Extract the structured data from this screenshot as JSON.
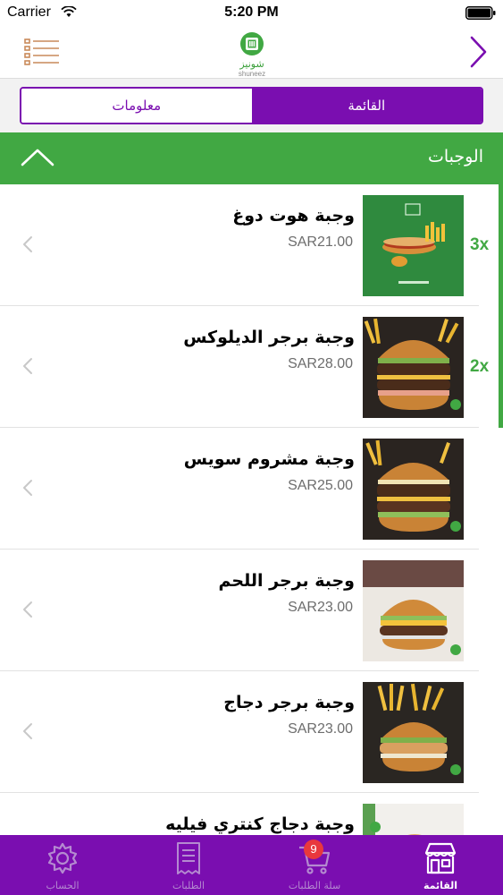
{
  "status_bar": {
    "carrier": "Carrier",
    "time": "5:20 PM"
  },
  "header": {
    "logo_text": "شونيز",
    "logo_subtext": "shuneez"
  },
  "segmented_control": {
    "info_label": "معلومات",
    "menu_label": "القائمة",
    "selected": "menu"
  },
  "category": {
    "title": "الوجبات",
    "expanded": true
  },
  "items": [
    {
      "name": "وجبة هوت دوغ",
      "price": "SAR21.00",
      "quantity": "3x"
    },
    {
      "name": "وجبة برجر الديلوكس",
      "price": "SAR28.00",
      "quantity": "2x"
    },
    {
      "name": "وجبة مشروم سويس",
      "price": "SAR25.00",
      "quantity": ""
    },
    {
      "name": "وجبة برجر اللحم",
      "price": "SAR23.00",
      "quantity": ""
    },
    {
      "name": "وجبة برجر دجاج",
      "price": "SAR23.00",
      "quantity": ""
    },
    {
      "name": "وجبة دجاج كنتري فيليه",
      "price": "",
      "quantity": ""
    }
  ],
  "tab_bar": {
    "tabs": [
      {
        "label": "الحساب",
        "icon": "gear-icon",
        "active": false
      },
      {
        "label": "الطلبات",
        "icon": "receipt-icon",
        "active": false
      },
      {
        "label": "سلة الطلبات",
        "icon": "cart-icon",
        "active": false,
        "badge": "9"
      },
      {
        "label": "القائمة",
        "icon": "store-icon",
        "active": true
      }
    ]
  },
  "colors": {
    "brand_purple": "#7a0eb0",
    "brand_green": "#41a843",
    "badge_red": "#e8383d"
  }
}
